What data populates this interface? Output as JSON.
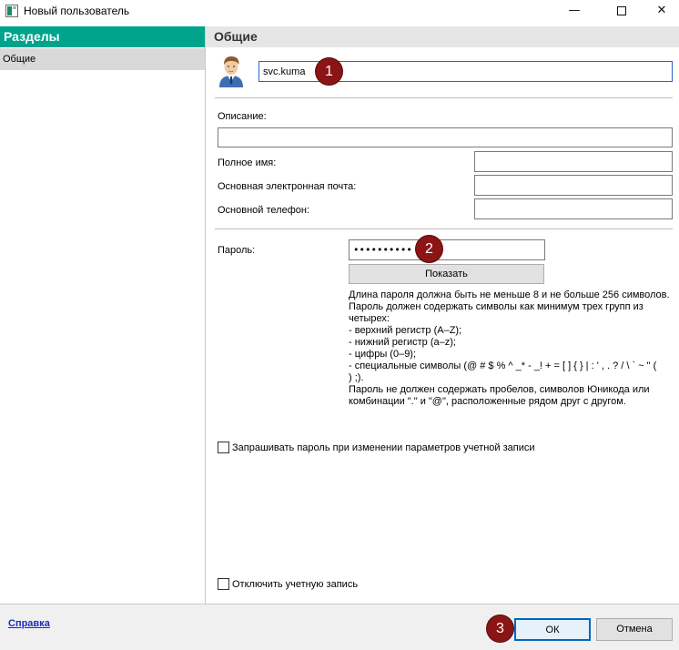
{
  "window": {
    "title": "Новый пользователь",
    "minimize_glyph": "—",
    "close_glyph": "✕"
  },
  "sidebar": {
    "header": "Разделы",
    "items": [
      {
        "label": "Общие",
        "selected": true
      }
    ]
  },
  "section": {
    "title": "Общие"
  },
  "form": {
    "name_value": "svc.kuma",
    "description_label": "Описание:",
    "description_value": "",
    "fullname_label": "Полное имя:",
    "fullname_value": "",
    "email_label": "Основная электронная почта:",
    "email_value": "",
    "phone_label": "Основной телефон:",
    "phone_value": "",
    "password_label": "Пароль:",
    "password_value": "••••••••••",
    "show_button_label": "Показать",
    "password_hint": [
      "Длина пароля должна быть не меньше 8 и не больше 256 символов.",
      "Пароль должен содержать символы как минимум трех групп из",
      "четырех:",
      "- верхний регистр (A–Z);",
      "- нижний регистр (a–z);",
      "- цифры (0–9);",
      "- специальные символы (@ # $ % ^ _* - _! + = [ ] { } | : ' , . ? / \\ ` ~ \" (",
      ") ;).",
      "Пароль не должен содержать пробелов, символов Юникода или",
      "комбинации \".\" и \"@\", расположенные рядом друг с другом."
    ],
    "require_password_change_label": "Запрашивать пароль при изменении параметров учетной записи",
    "require_password_change_checked": false,
    "disable_account_label": "Отключить учетную запись",
    "disable_account_checked": false
  },
  "footer": {
    "help_label": "Справка",
    "ok_label": "ОК",
    "cancel_label": "Отмена"
  },
  "annotations": {
    "badge1": "1",
    "badge2": "2",
    "badge3": "3",
    "badge_color": "#8b1414"
  },
  "colors": {
    "accent": "#00a38c",
    "selected_item": "#d9d9d9",
    "section_header": "#e6e6e6",
    "link": "#1a2bc4"
  },
  "icons": {
    "app": "app-window-icon",
    "avatar": "user-avatar-icon"
  }
}
